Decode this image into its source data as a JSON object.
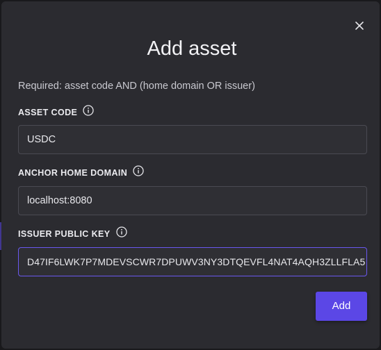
{
  "dialog": {
    "title": "Add asset",
    "subtitle": "Required: asset code AND (home domain OR issuer)",
    "close_icon": "close-icon"
  },
  "fields": {
    "asset_code": {
      "label": "ASSET CODE",
      "value": "USDC",
      "info_icon": "info-icon"
    },
    "home_domain": {
      "label": "ANCHOR HOME DOMAIN",
      "value": "localhost:8080",
      "info_icon": "info-icon"
    },
    "issuer": {
      "label": "ISSUER PUBLIC KEY",
      "value": "D47IF6LWK7P7MDEVSCWR7DPUWV3NY3DTQEVFL4NAT4AQH3ZLLFLA5",
      "info_icon": "info-icon"
    }
  },
  "actions": {
    "add_label": "Add"
  },
  "colors": {
    "accent": "#5b47e6",
    "modal_bg": "#2b2b30",
    "focus_border": "#6a58f0"
  }
}
